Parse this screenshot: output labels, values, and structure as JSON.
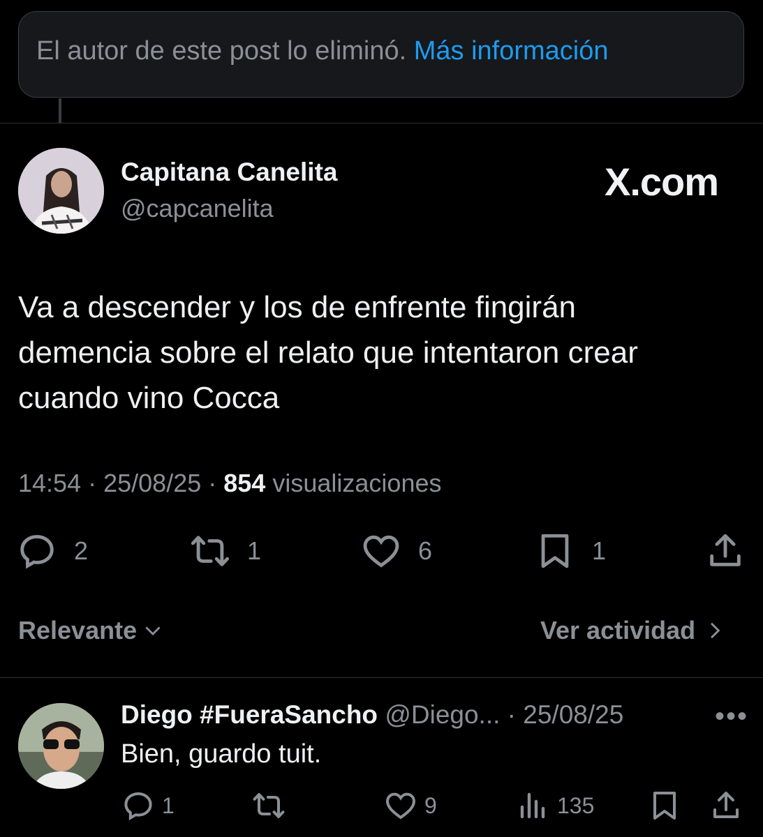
{
  "deleted_notice": {
    "text": "El autor de este post lo eliminó.",
    "link": "Más información"
  },
  "post": {
    "author_name": "Capitana Canelita",
    "author_handle": "@capcanelita",
    "source_brand": "X.com",
    "text_lines": [
      "Va a descender y los de enfrente fingirán",
      "demencia sobre el relato que intentaron crear",
      "cuando vino Cocca"
    ],
    "time": "14:54",
    "date": "25/08/25",
    "views_count": "854",
    "views_label": "visualizaciones",
    "actions": {
      "replies": "2",
      "reposts": "1",
      "likes": "6",
      "bookmarks": "1"
    }
  },
  "filters": {
    "sort_label": "Relevante",
    "activity_label": "Ver actividad"
  },
  "reply": {
    "author_name": "Diego #FueraSancho",
    "author_handle": "@Diego...",
    "date": "· 25/08/25",
    "more": "•••",
    "text": "Bien, guardo tuit.",
    "actions": {
      "replies": "1",
      "reposts": "",
      "likes": "9",
      "views": "135"
    }
  },
  "colors": {
    "accent": "#1d9bf0",
    "background": "#000000",
    "muted": "#8b9096",
    "text": "#e7e9ea"
  },
  "icons": [
    "reply-icon",
    "repost-icon",
    "like-icon",
    "bookmark-icon",
    "share-icon",
    "views-icon",
    "chevron-down-icon",
    "chevron-right-icon",
    "more-icon"
  ]
}
